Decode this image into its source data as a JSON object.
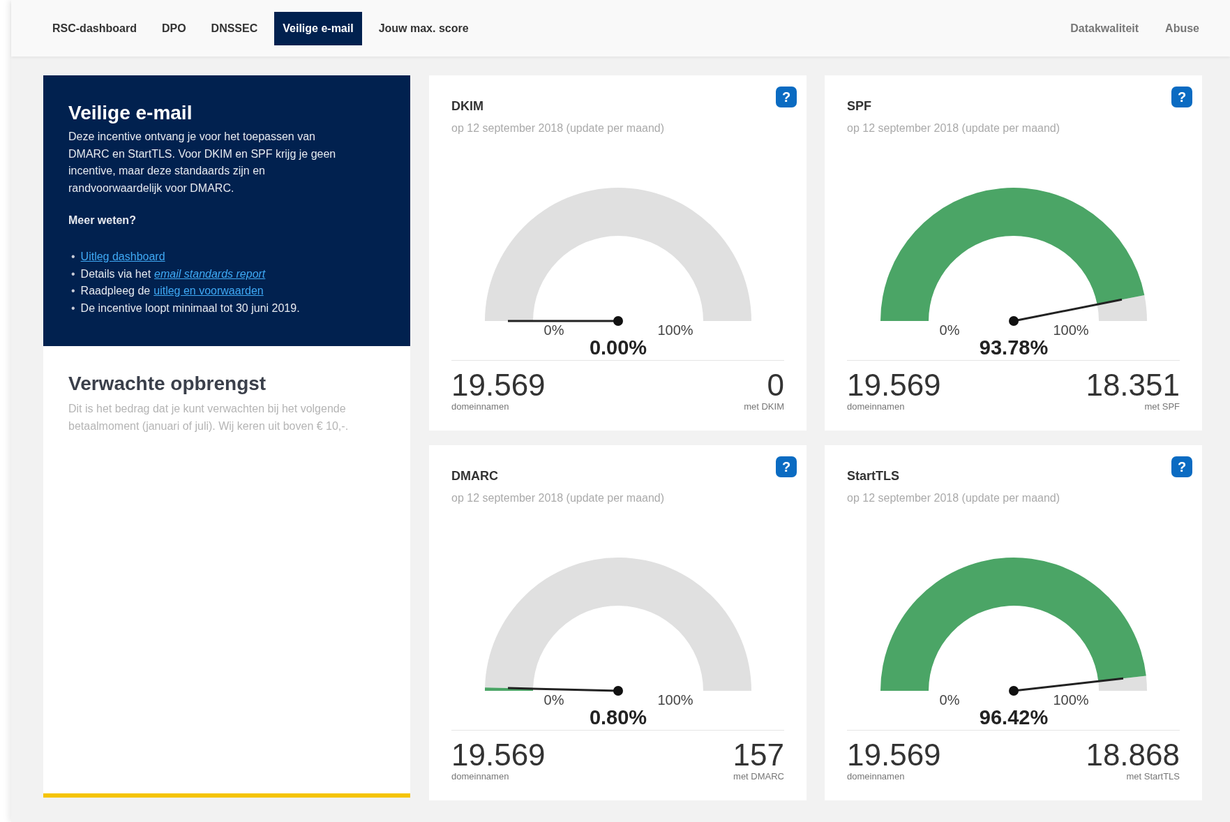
{
  "nav": {
    "tabs": [
      {
        "label": "RSC-dashboard",
        "selected": false
      },
      {
        "label": "DPO",
        "selected": false
      },
      {
        "label": "DNSSEC",
        "selected": false
      },
      {
        "label": "Veilige e-mail",
        "selected": true
      },
      {
        "label": "Jouw max. score",
        "selected": false
      }
    ],
    "right_links": [
      "Datakwaliteit",
      "Abuse"
    ]
  },
  "intro": {
    "title": "Veilige e-mail",
    "text": "Deze incentive ontvang je voor het toepassen van DMARC en StartTLS. Voor DKIM en SPF krijg je geen incentive, maar deze standaards zijn en randvoorwaardelijk voor DMARC.",
    "subheading": "Meer weten?",
    "bullets": [
      {
        "bullet": "•",
        "link": "Uitleg dashboard",
        "italic": false
      },
      {
        "bullet": "•",
        "prefix": "Details via het",
        "link": "email standards report",
        "italic": true
      },
      {
        "bullet": "•",
        "prefix": "Raadpleeg de",
        "link": "uitleg en voorwaarden",
        "italic": false
      },
      {
        "bullet": "•",
        "prefix": "De incentive loopt minimaal tot 30 juni 2019."
      }
    ]
  },
  "revenue": {
    "title": "Verwachte opbrengst",
    "text": "Dit is het bedrag dat je kunt verwachten bij het volgende betaalmoment (januari of juli). Wij keren uit boven € 10,-."
  },
  "cards": [
    {
      "title": "DKIM",
      "subtitle": "op 12 september 2018 (update per maand)",
      "help": "?",
      "min_label": "0%",
      "max_label": "100%",
      "percent": "0.00%",
      "total": "19.569",
      "total_label": "domeinnamen",
      "count": "0",
      "count_label": "met DKIM"
    },
    {
      "title": "SPF",
      "subtitle": "op 12 september 2018 (update per maand)",
      "help": "?",
      "min_label": "0%",
      "max_label": "100%",
      "percent": "93.78%",
      "total": "19.569",
      "total_label": "domeinnamen",
      "count": "18.351",
      "count_label": "met SPF"
    },
    {
      "title": "DMARC",
      "subtitle": "op 12 september 2018 (update per maand)",
      "help": "?",
      "min_label": "0%",
      "max_label": "100%",
      "percent": "0.80%",
      "total": "19.569",
      "total_label": "domeinnamen",
      "count": "157",
      "count_label": "met DMARC"
    },
    {
      "title": "StartTLS",
      "subtitle": "op 12 september 2018 (update per maand)",
      "help": "?",
      "min_label": "0%",
      "max_label": "100%",
      "percent": "96.42%",
      "total": "19.569",
      "total_label": "domeinnamen",
      "count": "18.868",
      "count_label": "met StartTLS"
    }
  ]
}
